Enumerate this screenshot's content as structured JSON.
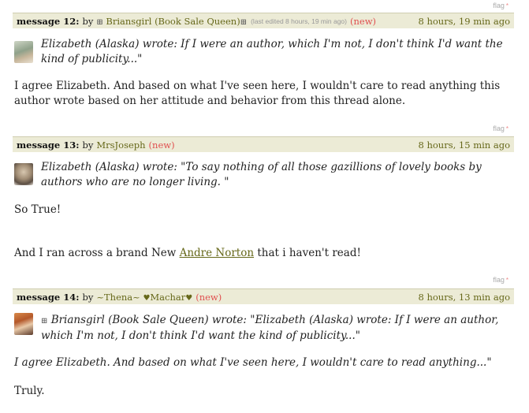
{
  "flag_label": "flag",
  "flag_star": "*",
  "messages": [
    {
      "label": "message 12:",
      "by": "by",
      "user": "Briansgirl (Book Sale Queen)",
      "edited": "(last edited 8 hours, 19 min ago)",
      "new": "(new)",
      "time": "8 hours, 19 min ago",
      "quote": "Elizabeth (Alaska) wrote: If I were an author, which I'm not, I don't think I'd want the kind of publicity...\"",
      "body": [
        "I agree Elizabeth. And based on what I've seen here, I wouldn't care to read anything this author wrote based on her attitude and behavior from this thread alone."
      ]
    },
    {
      "label": "message 13:",
      "by": "by",
      "user": "MrsJoseph",
      "new": "(new)",
      "time": "8 hours, 15 min ago",
      "quote": "Elizabeth (Alaska) wrote: \"To say nothing of all those gazillions of lovely books by authors who are no longer living. \"",
      "body": [
        "So True!"
      ],
      "body2_pre": "And I ran across a brand New ",
      "body2_link": "Andre Norton",
      "body2_post": " that i haven't read!"
    },
    {
      "label": "message 14:",
      "by": "by",
      "user_a": "~Thena~",
      "user_b": "Machar",
      "new": "(new)",
      "time": "8 hours, 13 min ago",
      "quote": "Briansgirl (Book Sale Queen) wrote: \"Elizabeth (Alaska) wrote: If I were an author, which I'm not, I don't think I'd want the kind of publicity...\"",
      "body": [
        "I agree Elizabeth. And based on what I've seen here, I wouldn't care to read anything...\"",
        "Truly."
      ]
    }
  ],
  "icons": {
    "grid": "⊞",
    "heart": "♥"
  }
}
